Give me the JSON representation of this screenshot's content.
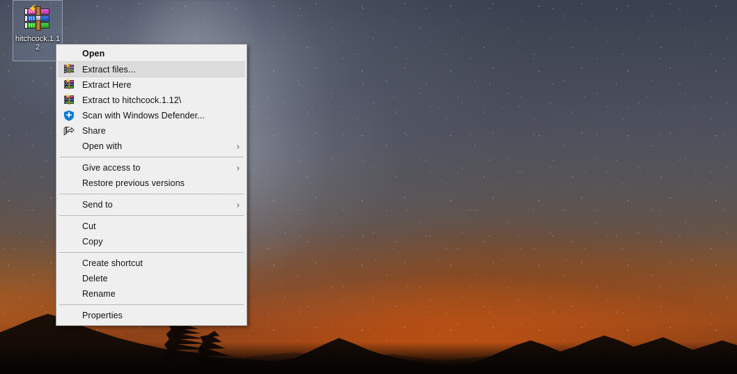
{
  "desktop": {
    "icon": {
      "name": "hitchcock.1.12",
      "label": "hitchcock.1.12",
      "icon_name": "winrar-archive-icon",
      "selected": true
    },
    "wallpaper_name": "milky-way-night-sky-mountains"
  },
  "context_menu": {
    "name": "file-context-menu",
    "groups": [
      {
        "items": [
          {
            "label": "Open",
            "icon": "none",
            "bold": true,
            "submenu": false,
            "highlighted": false
          },
          {
            "label": "Extract files...",
            "icon": "winrar-icon",
            "bold": false,
            "submenu": false,
            "highlighted": true
          },
          {
            "label": "Extract Here",
            "icon": "winrar-icon",
            "bold": false,
            "submenu": false,
            "highlighted": false
          },
          {
            "label": "Extract to hitchcock.1.12\\",
            "icon": "winrar-icon",
            "bold": false,
            "submenu": false,
            "highlighted": false
          },
          {
            "label": "Scan with Windows Defender...",
            "icon": "shield-icon",
            "bold": false,
            "submenu": false,
            "highlighted": false
          },
          {
            "label": "Share",
            "icon": "share-icon",
            "bold": false,
            "submenu": false,
            "highlighted": false
          },
          {
            "label": "Open with",
            "icon": "none",
            "bold": false,
            "submenu": true,
            "highlighted": false
          }
        ]
      },
      {
        "items": [
          {
            "label": "Give access to",
            "icon": "none",
            "bold": false,
            "submenu": true,
            "highlighted": false
          },
          {
            "label": "Restore previous versions",
            "icon": "none",
            "bold": false,
            "submenu": false,
            "highlighted": false
          }
        ]
      },
      {
        "items": [
          {
            "label": "Send to",
            "icon": "none",
            "bold": false,
            "submenu": true,
            "highlighted": false
          }
        ]
      },
      {
        "items": [
          {
            "label": "Cut",
            "icon": "none",
            "bold": false,
            "submenu": false,
            "highlighted": false
          },
          {
            "label": "Copy",
            "icon": "none",
            "bold": false,
            "submenu": false,
            "highlighted": false
          }
        ]
      },
      {
        "items": [
          {
            "label": "Create shortcut",
            "icon": "none",
            "bold": false,
            "submenu": false,
            "highlighted": false
          },
          {
            "label": "Delete",
            "icon": "none",
            "bold": false,
            "submenu": false,
            "highlighted": false
          },
          {
            "label": "Rename",
            "icon": "none",
            "bold": false,
            "submenu": false,
            "highlighted": false
          }
        ]
      },
      {
        "items": [
          {
            "label": "Properties",
            "icon": "none",
            "bold": false,
            "submenu": false,
            "highlighted": false
          }
        ]
      }
    ],
    "submenu_glyph": "›"
  },
  "colors": {
    "menu_background": "#f0f0f0",
    "menu_border": "#9a9a9a",
    "menu_highlight": "#dcdcdc",
    "menu_text": "#101010",
    "separator": "#b9b9b9",
    "icon_selection_fill": "#788aaa",
    "shield_blue": "#0a7ad6",
    "sky_top": "#3a4052",
    "horizon_orange": "#b55a1c"
  }
}
